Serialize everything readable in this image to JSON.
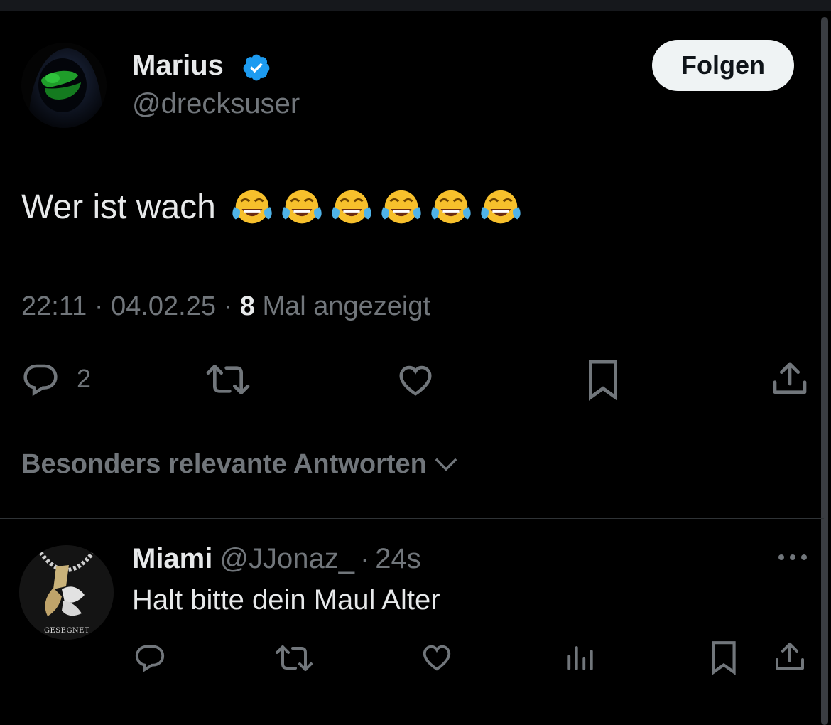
{
  "tweet": {
    "author_name": "Marius",
    "author_handle": "@drecksuser",
    "follow_label": "Folgen",
    "text": "Wer ist wach",
    "emojis": [
      "face-with-tears-of-joy",
      "face-with-tears-of-joy",
      "face-with-tears-of-joy",
      "face-with-tears-of-joy",
      "face-with-tears-of-joy",
      "face-with-tears-of-joy"
    ],
    "time": "22:11",
    "date": "04.02.25",
    "views_count": "8",
    "views_label": "Mal angezeigt",
    "reply_count": "2",
    "accent_color": "#1d9bf0"
  },
  "sort": {
    "label": "Besonders relevante Antworten"
  },
  "reply": {
    "author_name": "Miami",
    "author_handle": "@JJonaz_",
    "time": "24s",
    "text": "Halt bitte dein Maul Alter",
    "avatar_caption": "GESEGNET"
  },
  "icons": {
    "reply": "reply-icon",
    "retweet": "retweet-icon",
    "like": "like-icon",
    "bookmark": "bookmark-icon",
    "share": "share-icon",
    "views": "views-icon",
    "more": "more-icon",
    "verified": "verified-badge-icon",
    "chevron": "chevron-down-icon"
  }
}
